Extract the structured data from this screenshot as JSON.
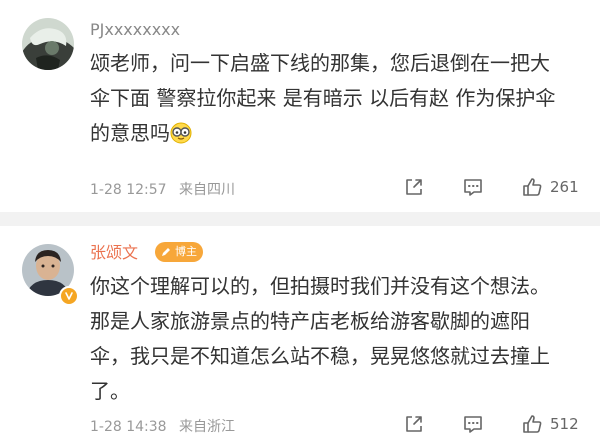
{
  "comments": [
    {
      "username": "PJxxxxxxxx",
      "text_lines": [
        "颂老师，问一下启盛下线的那集，您后退倒在一把大",
        "伞下面 警察拉你起来 是有暗示 以后有赵 作为保护伞",
        "的意思吗"
      ],
      "emoji": "glasses-emoji",
      "date": "1-28 12:57",
      "location": "来自四川",
      "like_count": "261",
      "icons": {
        "share": "share-icon",
        "comment": "comment-icon",
        "like": "thumbs-up-icon"
      }
    },
    {
      "username": "张颂文",
      "badge": "博主",
      "verified": true,
      "text_lines": [
        "你这个理解可以的，但拍摄时我们并没有这个想法。",
        "那是人家旅游景点的特产店老板给游客歇脚的遮阳",
        "伞，我只是不知道怎么站不稳，晃晃悠悠就过去撞上",
        "了。"
      ],
      "date": "1-28 14:38",
      "location": "来自浙江",
      "like_count": "512",
      "icons": {
        "share": "share-icon",
        "comment": "comment-icon",
        "like": "thumbs-up-icon"
      }
    }
  ],
  "colors": {
    "author_name": "#eb7350",
    "badge_bg": "#f7a73a",
    "verified": "#f5a623",
    "separator": "#f2f2f2",
    "meta": "#999999"
  }
}
